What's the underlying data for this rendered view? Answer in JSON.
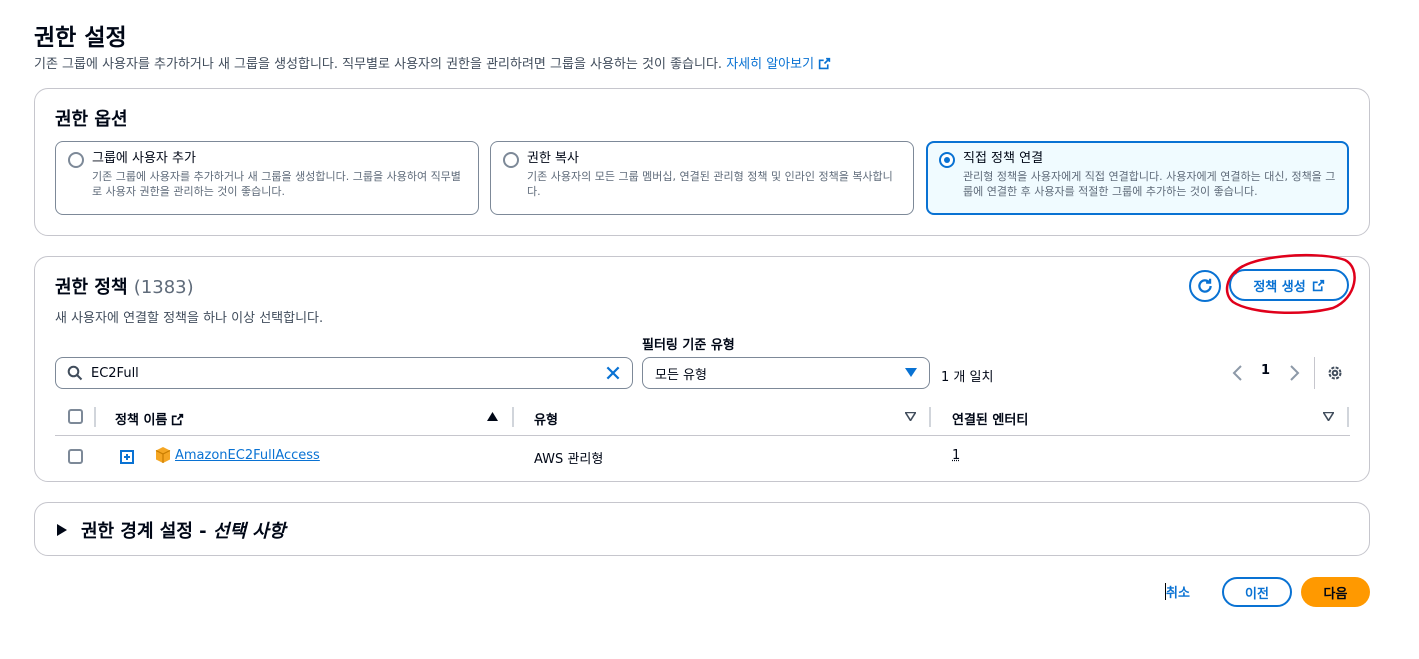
{
  "header": {
    "title": "권한 설정",
    "description": "기존 그룹에 사용자를 추가하거나 새 그룹을 생성합니다. 직무별로 사용자의 권한을 관리하려면 그룹을 사용하는 것이 좋습니다.",
    "learn_more": "자세히 알아보기"
  },
  "permission_options": {
    "heading": "권한 옵션",
    "options": [
      {
        "title": "그룹에 사용자 추가",
        "description": "기존 그룹에 사용자를 추가하거나 새 그룹을 생성합니다. 그룹을 사용하여 직무별로 사용자 권한을 관리하는 것이 좋습니다.",
        "selected": false
      },
      {
        "title": "권한 복사",
        "description": "기존 사용자의 모든 그룹 멤버십, 연결된 관리형 정책 및 인라인 정책을 복사합니다.",
        "selected": false
      },
      {
        "title": "직접 정책 연결",
        "description": "관리형 정책을 사용자에게 직접 연결합니다. 사용자에게 연결하는 대신, 정책을 그룹에 연결한 후 사용자를 적절한 그룹에 추가하는 것이 좋습니다.",
        "selected": true
      }
    ]
  },
  "policies": {
    "heading": "권한 정책",
    "count": "(1383)",
    "description": "새 사용자에 연결할 정책을 하나 이상 선택합니다.",
    "create_button": "정책 생성",
    "filter_label": "필터링 기준 유형",
    "search_value": "EC2Full",
    "type_filter_value": "모든 유형",
    "match_count": "1 개 일치",
    "page_number": "1",
    "columns": [
      "정책 이름",
      "유형",
      "연결된 엔터티"
    ],
    "rows": [
      {
        "name": "AmazonEC2FullAccess",
        "type": "AWS 관리형",
        "entities": "1"
      }
    ]
  },
  "boundary": {
    "title": "권한 경계 설정 - ",
    "optional": "선택 사항"
  },
  "footer": {
    "cancel": "취소",
    "previous": "이전",
    "next": "다음"
  },
  "colors": {
    "accent": "#0972d3",
    "primary_button": "#ff9900",
    "annotation": "#e0001b"
  },
  "icons": [
    "external-link-icon",
    "refresh-icon",
    "search-icon",
    "clear-icon",
    "caret-down-icon",
    "chevron-left-icon",
    "chevron-right-icon",
    "settings-icon",
    "sort-asc-icon",
    "sort-desc-icon",
    "expand-icon",
    "aws-box-icon",
    "caret-right-icon"
  ]
}
